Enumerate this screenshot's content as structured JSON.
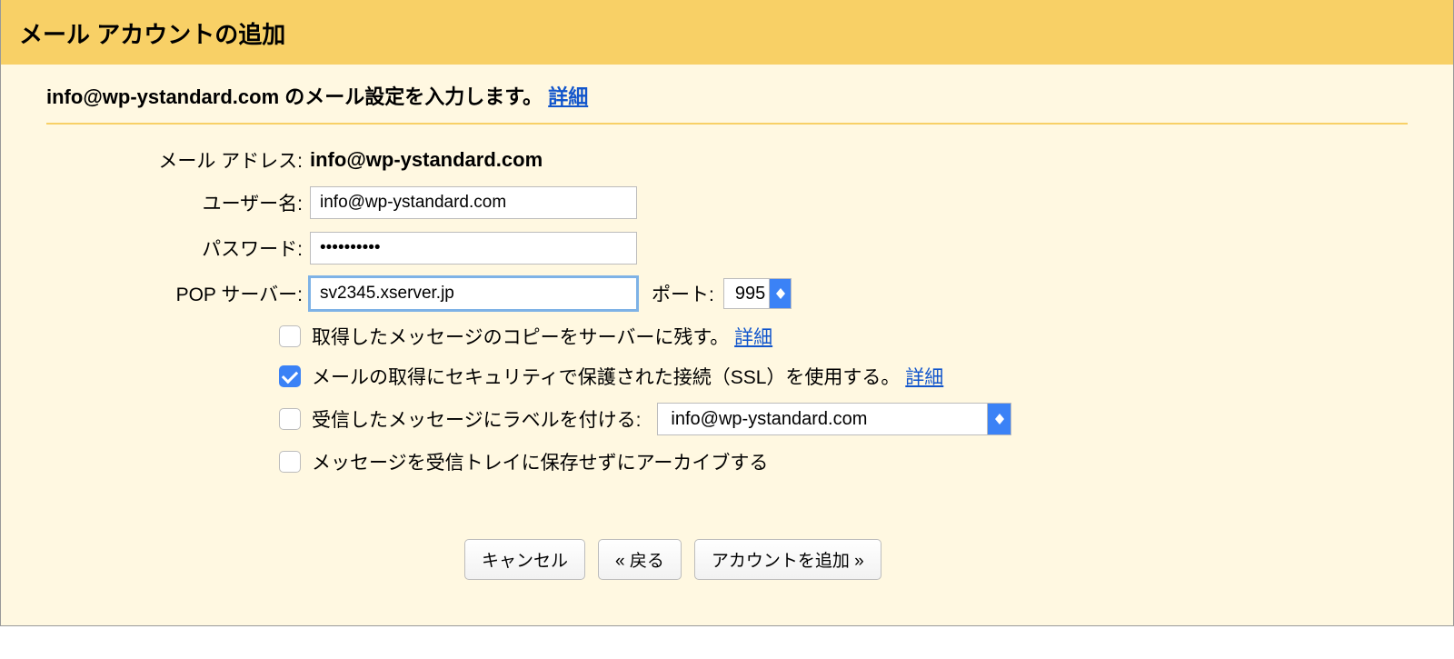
{
  "header": {
    "title": "メール アカウントの追加"
  },
  "subhead": {
    "text_pre": "info@wp-ystandard.com のメール設定を入力します。",
    "link": "詳細"
  },
  "form": {
    "email_address": {
      "label": "メール アドレス:",
      "value": "info@wp-ystandard.com"
    },
    "username": {
      "label": "ユーザー名:",
      "value": "info@wp-ystandard.com"
    },
    "password": {
      "label": "パスワード:",
      "value": "••••••••••"
    },
    "pop_server": {
      "label": "POP サーバー:",
      "value": "sv2345.xserver.jp"
    },
    "port": {
      "label": "ポート:",
      "value": "995"
    }
  },
  "options": {
    "leave_copy": {
      "label": "取得したメッセージのコピーをサーバーに残す。",
      "link": "詳細",
      "checked": false
    },
    "use_ssl": {
      "label": "メールの取得にセキュリティで保護された接続（SSL）を使用する。",
      "link": "詳細",
      "checked": true
    },
    "apply_label": {
      "label": "受信したメッセージにラベルを付ける:",
      "select_value": "info@wp-ystandard.com",
      "checked": false
    },
    "archive": {
      "label": "メッセージを受信トレイに保存せずにアーカイブする",
      "checked": false
    }
  },
  "buttons": {
    "cancel": "キャンセル",
    "back": "« 戻る",
    "add": "アカウントを追加 »"
  }
}
